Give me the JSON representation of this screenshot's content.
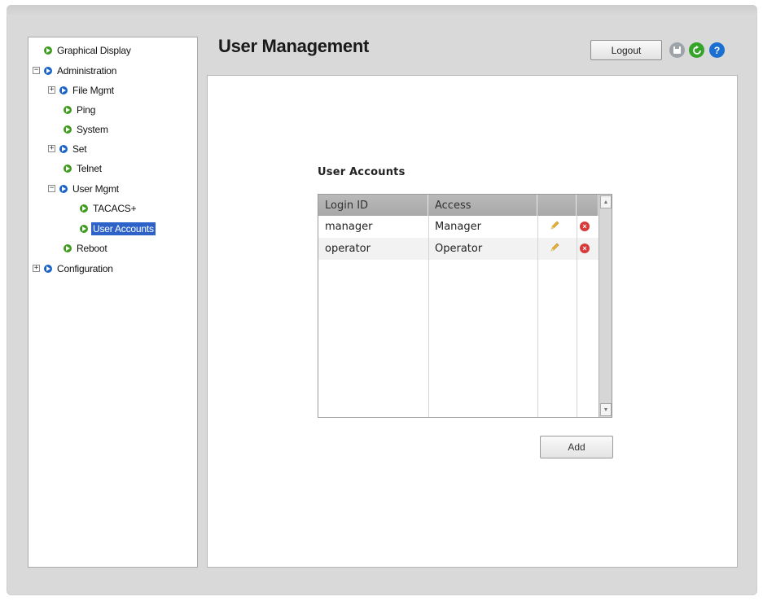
{
  "header": {
    "title": "User Management",
    "logout_label": "Logout",
    "icons": [
      "save-icon",
      "refresh-icon",
      "help-icon"
    ]
  },
  "sidebar": {
    "items": [
      {
        "label": "Graphical Display",
        "expander": "",
        "icon": "green"
      },
      {
        "label": "Administration",
        "expander": "−",
        "icon": "blue"
      },
      {
        "label": "File Mgmt",
        "expander": "+",
        "icon": "blue"
      },
      {
        "label": "Ping",
        "expander": "",
        "icon": "green"
      },
      {
        "label": "System",
        "expander": "",
        "icon": "green"
      },
      {
        "label": "Set",
        "expander": "+",
        "icon": "blue"
      },
      {
        "label": "Telnet",
        "expander": "",
        "icon": "green"
      },
      {
        "label": "User Mgmt",
        "expander": "−",
        "icon": "blue"
      },
      {
        "label": "TACACS+",
        "expander": "",
        "icon": "green"
      },
      {
        "label": "User Accounts",
        "expander": "",
        "icon": "green",
        "selected": true
      },
      {
        "label": "Reboot",
        "expander": "",
        "icon": "green"
      },
      {
        "label": "Configuration",
        "expander": "+",
        "icon": "blue"
      }
    ]
  },
  "main": {
    "section_title": "User Accounts",
    "table": {
      "columns": [
        "Login ID",
        "Access",
        "",
        ""
      ],
      "rows": [
        {
          "login_id": "manager",
          "access": "Manager"
        },
        {
          "login_id": "operator",
          "access": "Operator"
        }
      ]
    },
    "add_label": "Add"
  },
  "colors": {
    "selected_bg": "#2d63c8",
    "tree_green": "#3f9b1f",
    "tree_blue": "#1a63c9",
    "delete_red": "#d93a3a",
    "edit_yellow": "#e2a320"
  }
}
